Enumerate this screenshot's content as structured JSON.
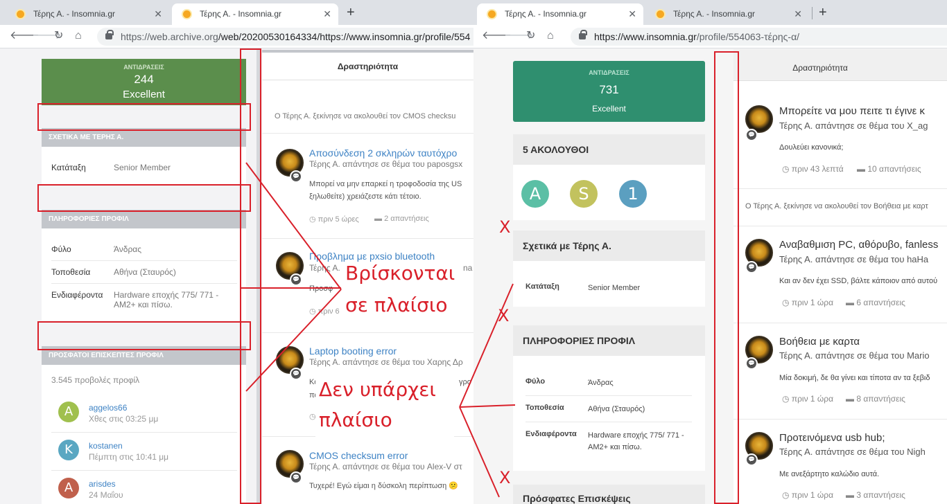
{
  "left_window": {
    "tabs": [
      {
        "title": "Τέρης Α. - Insomnia.gr"
      },
      {
        "title": "Τέρης Α. - Insomnia.gr"
      }
    ],
    "url_host": "https://web.archive.org",
    "url_path": "/web/20200530164334/https://www.insomnia.gr/profile/554",
    "reputation": {
      "label": "ΑΝΤΙΔΡΑΣΕΙΣ",
      "value": "244",
      "rating": "Excellent"
    },
    "about": {
      "header": "ΣΧΕΤΙΚΑ ΜΕ ΤΕΡΗΣ Α.",
      "rank_key": "Κατάταξη",
      "rank_val": "Senior Member"
    },
    "profile_info": {
      "header": "ΠΛΗΡΟΦΟΡΙΕΣ ΠΡΟΦΙΛ",
      "rows": [
        {
          "k": "Φύλο",
          "v": "Άνδρας"
        },
        {
          "k": "Τοποθεσία",
          "v": "Αθήνα (Σταυρός)"
        },
        {
          "k": "Ενδιαφέροντα",
          "v": "Hardware εποχής 775/ 771 - AM2+ και πίσω."
        }
      ]
    },
    "visitors": {
      "header": "ΠΡΟΣΦΑΤΟΙ ΕΠΙΣΚΕΠΤΕΣ ΠΡΟΦΙΛ",
      "views": "3.545 προβολές προφίλ",
      "users": [
        {
          "initial": "A",
          "name": "aggelos66",
          "time": "Χθες στις 03:25 μμ",
          "color": "#a0c04e"
        },
        {
          "initial": "K",
          "name": "kostanen",
          "time": "Πέμπτη στις 10:41 μμ",
          "color": "#5aa7c2"
        },
        {
          "initial": "A",
          "name": "arisdes",
          "time": "24 Μαΐου",
          "color": "#c0604c"
        }
      ]
    },
    "activity_tab": "Δραστηριότητα",
    "follow_line": "Ο Τέρης Α. ξεκίνησε να ακολουθεί τον CMOS checksu",
    "posts": [
      {
        "title": "Αποσύνδεση 2 σκληρών ταυτόχρο",
        "sub": "Τέρης Α. απάντησε σε θέμα του papos­gsx",
        "body1": "Μπορεί να μην επαρκεί η τροφοδοσία της US",
        "body2": "ξηλωθείτε) χρειάζεστε κάτι τέτοιο.",
        "time": "πριν 5 ώρες",
        "replies": "2 απαντήσεις"
      },
      {
        "title": "Προβλημα με pxsio bluetooth",
        "sub": "Τέρης Α.",
        "sub2": "na",
        "body1": "Προσφ",
        "time": "πριν 6"
      },
      {
        "title": "Laptop booting error",
        "sub": "Τέρης Α. απάντησε σε θέμα του Χαρης Δρ",
        "body1": "Κά",
        "body1b": "γρο",
        "body2": "πα"
      },
      {
        "title": "CMOS checksum error",
        "sub": "Τέρης Α. απάντησε σε θέμα του Alex-V στ",
        "body1": "Τυχερέ! Εγώ είμαι η δύσκολη περίπτωση 😕"
      }
    ]
  },
  "right_window": {
    "tabs": [
      {
        "title": "Τέρης Α. - Insomnia.gr"
      },
      {
        "title": "Τέρης Α. - Insomnia.gr"
      }
    ],
    "url_host": "https://www.insomnia.gr",
    "url_path": "/profile/554063-τέρης-α/",
    "reputation": {
      "label": "ΑΝΤΙΔΡΑΣΕΙΣ",
      "value": "731",
      "rating": "Excellent"
    },
    "followers": {
      "header": "5 ΑΚΟΛΟΥΘΟΙ",
      "avatars": [
        {
          "initial": "A",
          "color": "#5bbfa5"
        },
        {
          "initial": "S",
          "color": "#c2c25e"
        },
        {
          "initial": "1",
          "color": "#5b9fc0"
        }
      ]
    },
    "about": {
      "header": "Σχετικά με Τέρης Α.",
      "rank_key": "Κατάταξη",
      "rank_val": "Senior Member"
    },
    "profile_info": {
      "header": "ΠΛΗΡΟΦΟΡΙΕΣ ΠΡΟΦΙΛ",
      "rows": [
        {
          "k": "Φύλο",
          "v": "Άνδρας"
        },
        {
          "k": "Τοποθεσία",
          "v": "Αθήνα (Σταυρός)"
        },
        {
          "k": "Ενδιαφέροντα",
          "v": "Hardware εποχής 775/ 771 - AM2+ και πίσω."
        }
      ]
    },
    "recent_header": "Πρόσφατες Επισκέψεις",
    "activity_tab": "Δραστηριότητα",
    "follow_line": "Ο Τέρης Α. ξεκίνησε να ακολουθεί τον Βοήθεια με καρτ",
    "posts": [
      {
        "title": "Μπορείτε να μου πειτε τι έγινε κ",
        "sub": "Τέρης Α. απάντησε σε θέμα του X_ag",
        "body": "Δουλεύει κανονικά;",
        "time": "πριν 43 λεπτά",
        "replies": "10 απαντήσεις"
      },
      {
        "title": "Αναβαθμιση PC, αθόρυβο, fanless",
        "sub": "Τέρης Α. απάντησε σε θέμα του haHa",
        "body": "Και αν δεν έχει SSD, βάλτε κάποιον από αυτού",
        "time": "πριν 1 ώρα",
        "replies": "6 απαντήσεις"
      },
      {
        "title": "Βοήθεια με καρτα",
        "sub": "Τέρης Α. απάντησε σε θέμα του Mario",
        "body": "Μία δοκιμή, δε θα γίνει και τίποτα αν τα ξεβιδ",
        "time": "πριν 1 ώρα",
        "replies": "8 απαντήσεις"
      },
      {
        "title": "Προτεινόμενα usb hub;",
        "sub": "Τέρης Α. απάντησε σε θέμα του Nigh",
        "body": "Με ανεξάρτητο καλώδιο αυτά.",
        "time": "πριν 1 ώρα",
        "replies": "3 απαντήσεις"
      }
    ]
  },
  "annotations": {
    "text1_line1": "Βρίσκονται",
    "text1_line2": "σε πλαίσιο",
    "text2_line1": "Δεν υπάρχει",
    "text2_line2": "πλαίσιο",
    "x_mark": "X",
    "color": "#d9202a"
  }
}
